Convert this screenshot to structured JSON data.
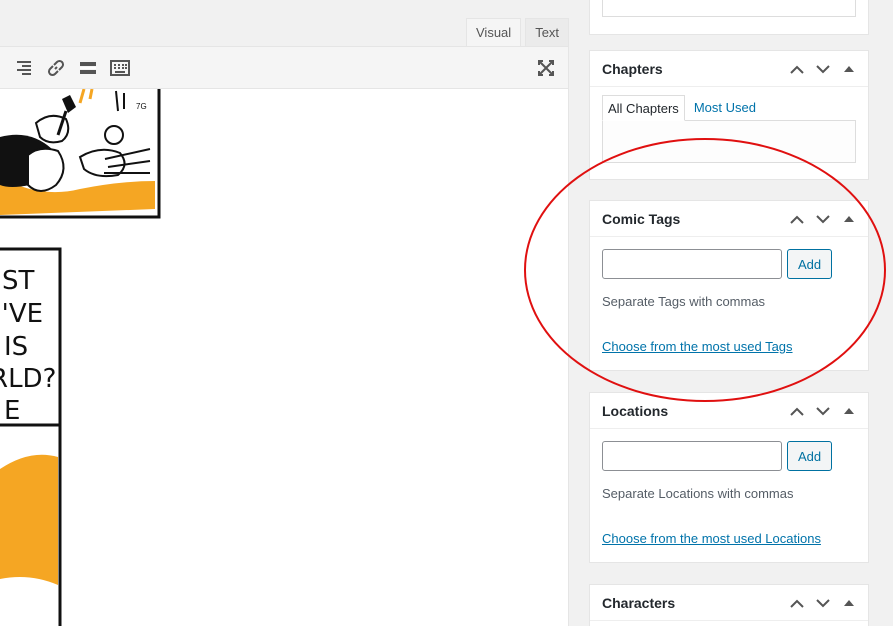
{
  "editor": {
    "tabs": [
      {
        "label": "Visual",
        "active": true
      },
      {
        "label": "Text",
        "active": false
      }
    ],
    "toolbar_icons": [
      "align-right-icon",
      "link-icon",
      "read-more-icon",
      "toolbar-toggle-icon"
    ],
    "expand_icon": "fullscreen-icon",
    "comic_text_lines": [
      "ST",
      "I'VE",
      "IS",
      "RLD?",
      "E"
    ],
    "accent_color": "#f5a623"
  },
  "sidebar": {
    "chapters": {
      "title": "Chapters",
      "tabs": [
        "All Chapters",
        "Most Used"
      ]
    },
    "comic_tags": {
      "title": "Comic Tags",
      "add_label": "Add",
      "hint": "Separate Tags with commas",
      "link": "Choose from the most used Tags"
    },
    "locations": {
      "title": "Locations",
      "add_label": "Add",
      "hint": "Separate Locations with commas",
      "link": "Choose from the most used Locations"
    },
    "characters": {
      "title": "Characters"
    }
  },
  "annotation": {
    "color": "#e01010",
    "shape": "ellipse"
  }
}
